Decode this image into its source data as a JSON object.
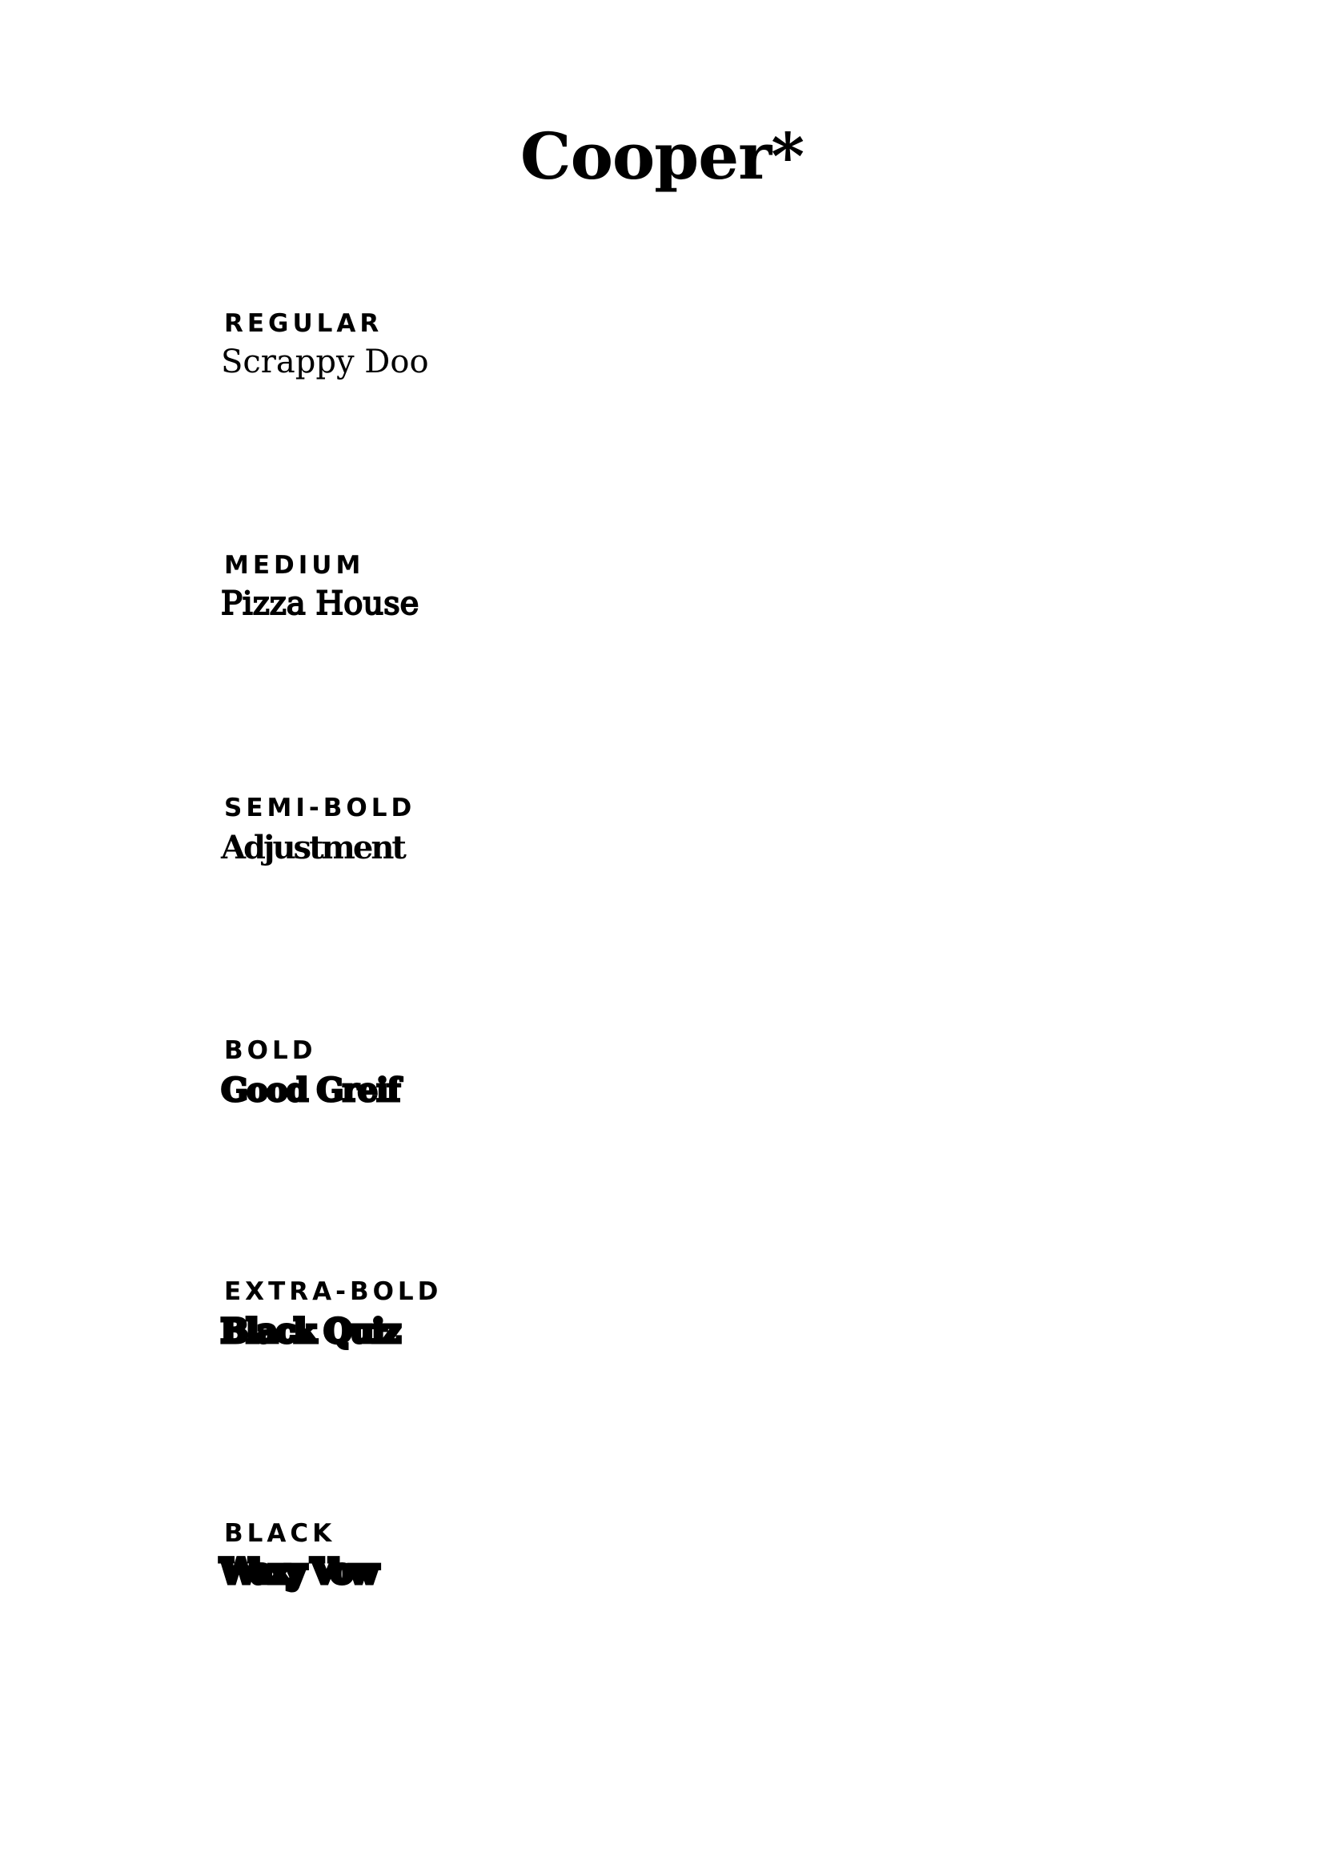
{
  "title": "Cooper*",
  "specimens": [
    {
      "weight": "REGULAR",
      "sample": "Scrappy Doo"
    },
    {
      "weight": "MEDIUM",
      "sample": "Pizza House"
    },
    {
      "weight": "SEMI-BOLD",
      "sample": "Adjustment"
    },
    {
      "weight": "BOLD",
      "sample": "Good Greif"
    },
    {
      "weight": "EXTRA-BOLD",
      "sample": "Black Quiz"
    },
    {
      "weight": "BLACK",
      "sample": "Waxy Vow"
    }
  ],
  "colors": {
    "background": "#ffffff",
    "text": "#000000"
  }
}
